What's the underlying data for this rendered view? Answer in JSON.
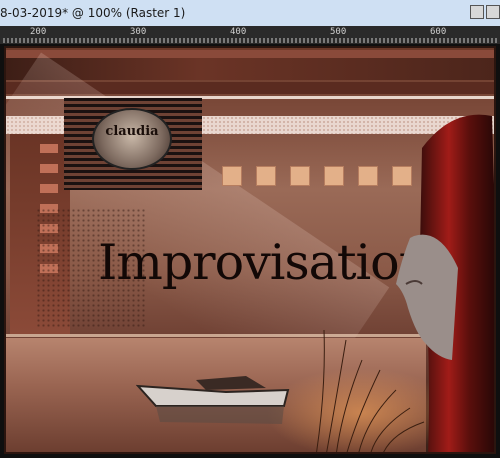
{
  "window": {
    "title": "8-03-2019* @ 100% (Raster 1)"
  },
  "ruler": {
    "labels": [
      "200",
      "300",
      "400",
      "500",
      "600"
    ]
  },
  "canvas": {
    "logo_text": "claudia",
    "headline": "Improvisation"
  },
  "colors": {
    "titlebar_bg": "#cfe0f3",
    "ruler_bg": "#2a2a2a",
    "art_brown": "#7c4a3a"
  }
}
